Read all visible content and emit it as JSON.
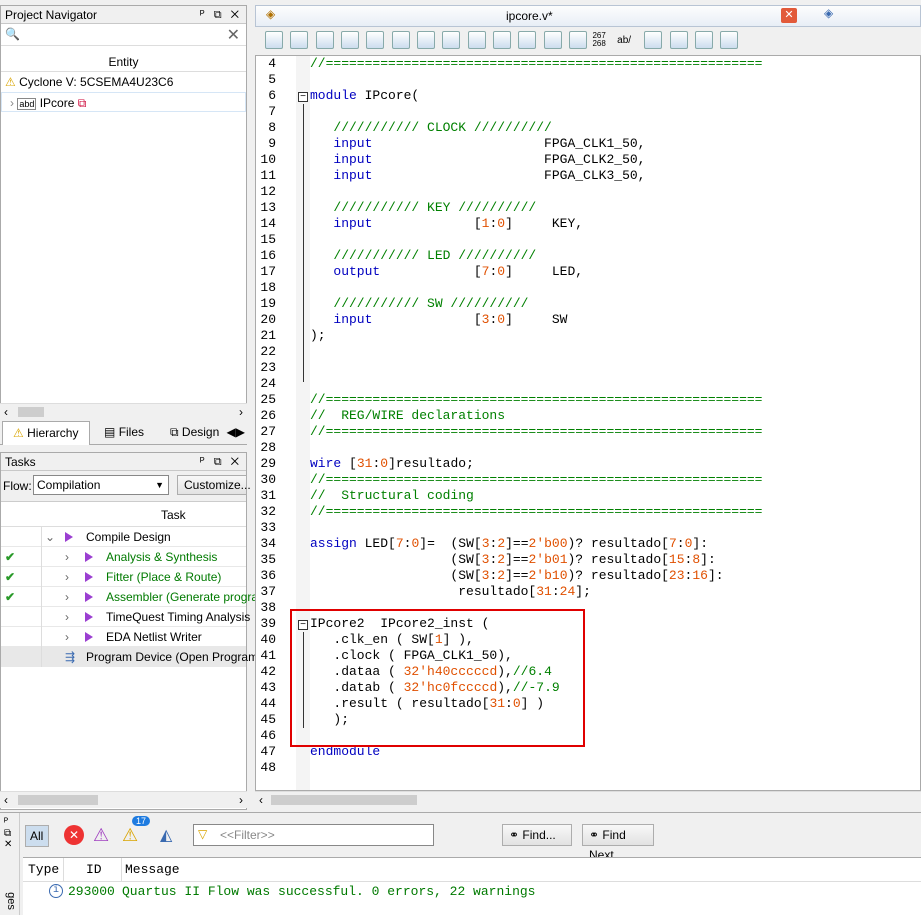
{
  "navigator": {
    "title": "Project Navigator",
    "entity_header": "Entity",
    "device": "Cyclone V: 5CSEMA4U23C6",
    "top_entity": "IPcore",
    "tabs": [
      "Hierarchy",
      "Files",
      "Design"
    ]
  },
  "tasks": {
    "title": "Tasks",
    "flow_label": "Flow:",
    "flow_value": "Compilation",
    "customize": "Customize...",
    "task_header": "Task",
    "items": [
      {
        "label": "Compile Design",
        "status": "",
        "color": "#000",
        "indent": 0
      },
      {
        "label": "Analysis & Synthesis",
        "status": "done",
        "color": "#007a00",
        "indent": 1
      },
      {
        "label": "Fitter (Place & Route)",
        "status": "done",
        "color": "#007a00",
        "indent": 1
      },
      {
        "label": "Assembler (Generate program",
        "status": "done",
        "color": "#007a00",
        "indent": 1
      },
      {
        "label": "TimeQuest Timing Analysis",
        "status": "",
        "color": "#000",
        "indent": 1
      },
      {
        "label": "EDA Netlist Writer",
        "status": "",
        "color": "#000",
        "indent": 1
      },
      {
        "label": "Program Device (Open Programme",
        "status": "",
        "color": "#000",
        "indent": 0
      }
    ]
  },
  "editor": {
    "tab_title": "ipcore.v*",
    "toolbar_nums": [
      "267",
      "268"
    ],
    "toolbar_ab": "ab/"
  },
  "code": [
    {
      "n": "4",
      "t": "//========================================================",
      "c": "cm"
    },
    {
      "n": "5",
      "t": "",
      "c": ""
    },
    {
      "n": "6",
      "t": "module IPcore(",
      "c": "kwmix"
    },
    {
      "n": "7",
      "t": "",
      "c": ""
    },
    {
      "n": "8",
      "t": "   /////////// CLOCK //////////",
      "c": "cm"
    },
    {
      "n": "9",
      "t": "   input                      FPGA_CLK1_50,",
      "c": "in"
    },
    {
      "n": "10",
      "t": "   input                      FPGA_CLK2_50,",
      "c": "in"
    },
    {
      "n": "11",
      "t": "   input                      FPGA_CLK3_50,",
      "c": "in"
    },
    {
      "n": "12",
      "t": "",
      "c": ""
    },
    {
      "n": "13",
      "t": "   /////////// KEY //////////",
      "c": "cm"
    },
    {
      "n": "14",
      "t": "   input             [1:0]     KEY,",
      "c": "in"
    },
    {
      "n": "15",
      "t": "",
      "c": ""
    },
    {
      "n": "16",
      "t": "   /////////// LED //////////",
      "c": "cm"
    },
    {
      "n": "17",
      "t": "   output            [7:0]     LED,",
      "c": "in"
    },
    {
      "n": "18",
      "t": "",
      "c": ""
    },
    {
      "n": "19",
      "t": "   /////////// SW //////////",
      "c": "cm"
    },
    {
      "n": "20",
      "t": "   input             [3:0]     SW",
      "c": "in"
    },
    {
      "n": "21",
      "t": ");",
      "c": ""
    },
    {
      "n": "22",
      "t": "",
      "c": ""
    },
    {
      "n": "23",
      "t": "",
      "c": ""
    },
    {
      "n": "24",
      "t": "",
      "c": ""
    },
    {
      "n": "25",
      "t": "//========================================================",
      "c": "cm"
    },
    {
      "n": "26",
      "t": "//  REG/WIRE declarations",
      "c": "cm"
    },
    {
      "n": "27",
      "t": "//========================================================",
      "c": "cm"
    },
    {
      "n": "28",
      "t": "",
      "c": ""
    },
    {
      "n": "29",
      "t": "wire [31:0]resultado;",
      "c": "in"
    },
    {
      "n": "30",
      "t": "//========================================================",
      "c": "cm"
    },
    {
      "n": "31",
      "t": "//  Structural coding",
      "c": "cm"
    },
    {
      "n": "32",
      "t": "//========================================================",
      "c": "cm"
    },
    {
      "n": "33",
      "t": "",
      "c": ""
    },
    {
      "n": "34",
      "t": "assign LED[7:0]=  (SW[3:2]==2'b00)? resultado[7:0]:",
      "c": "in"
    },
    {
      "n": "35",
      "t": "                  (SW[3:2]==2'b01)? resultado[15:8]:",
      "c": ""
    },
    {
      "n": "36",
      "t": "                  (SW[3:2]==2'b10)? resultado[23:16]:",
      "c": ""
    },
    {
      "n": "37",
      "t": "                   resultado[31:24];",
      "c": ""
    },
    {
      "n": "38",
      "t": "",
      "c": ""
    },
    {
      "n": "39",
      "t": "IPcore2  IPcore2_inst (",
      "c": ""
    },
    {
      "n": "40",
      "t": "   .clk_en ( SW[1] ),",
      "c": ""
    },
    {
      "n": "41",
      "t": "   .clock ( FPGA_CLK1_50),",
      "c": ""
    },
    {
      "n": "42",
      "t": "   .dataa ( 32'h40cccccd),//6.4",
      "c": "cmtail"
    },
    {
      "n": "43",
      "t": "   .datab ( 32'hc0fccccd),//-7.9",
      "c": "cmtail"
    },
    {
      "n": "44",
      "t": "   .result ( resultado[31:0] )",
      "c": ""
    },
    {
      "n": "45",
      "t": "   );",
      "c": ""
    },
    {
      "n": "46",
      "t": "",
      "c": ""
    },
    {
      "n": "47",
      "t": "endmodule",
      "c": "kw"
    },
    {
      "n": "48",
      "t": "",
      "c": ""
    }
  ],
  "messages": {
    "all": "All",
    "badge": "17",
    "filter_placeholder": "<<Filter>>",
    "find": "Find...",
    "find_next": "Find Next",
    "cols": {
      "type": "Type",
      "id": "ID",
      "message": "Message"
    },
    "row": {
      "id": "293000",
      "text": "Quartus II Flow was successful. 0 errors, 22 warnings"
    },
    "side_tab": "ges"
  }
}
